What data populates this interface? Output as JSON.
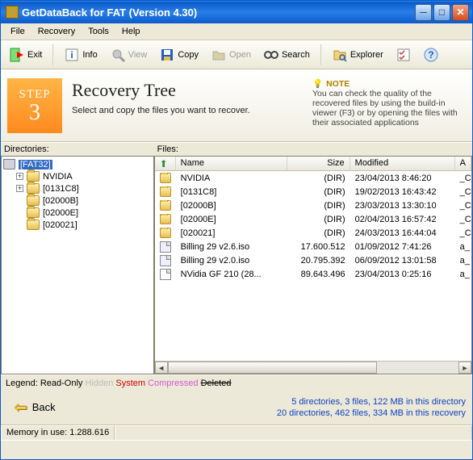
{
  "titlebar": {
    "title": "GetDataBack for FAT (Version 4.30)"
  },
  "menu": {
    "file": "File",
    "recovery": "Recovery",
    "tools": "Tools",
    "help": "Help"
  },
  "toolbar": {
    "exit": "Exit",
    "info": "Info",
    "view": "View",
    "copy": "Copy",
    "open": "Open",
    "search": "Search",
    "explorer": "Explorer"
  },
  "step": {
    "label": "STEP",
    "number": "3",
    "title": "Recovery Tree",
    "subtitle": "Select and copy the files you want to recover."
  },
  "note": {
    "heading": "NOTE",
    "body": "You can check the quality of the recovered files by using the build-in viewer (F3) or by opening the files with their associated applications"
  },
  "labels": {
    "directories": "Directories:",
    "files": "Files:"
  },
  "tree": {
    "root": "[FAT32]",
    "items": [
      {
        "name": "NVIDIA",
        "expandable": true
      },
      {
        "name": "[0131C8]",
        "expandable": true
      },
      {
        "name": "[02000B]",
        "expandable": false
      },
      {
        "name": "[02000E]",
        "expandable": false
      },
      {
        "name": "[020021]",
        "expandable": false
      }
    ]
  },
  "columns": {
    "name": "Name",
    "size": "Size",
    "modified": "Modified",
    "attr": "A"
  },
  "files": [
    {
      "icon": "folder",
      "name": "NVIDIA",
      "size": "(DIR)",
      "modified": "23/04/2013 8:46:20",
      "attr": "_C"
    },
    {
      "icon": "folder",
      "name": "[0131C8]",
      "size": "(DIR)",
      "modified": "19/02/2013 16:43:42",
      "attr": "_C"
    },
    {
      "icon": "folder",
      "name": "[02000B]",
      "size": "(DIR)",
      "modified": "23/03/2013 13:30:10",
      "attr": "_C"
    },
    {
      "icon": "folder",
      "name": "[02000E]",
      "size": "(DIR)",
      "modified": "02/04/2013 16:57:42",
      "attr": "_C"
    },
    {
      "icon": "folder",
      "name": "[020021]",
      "size": "(DIR)",
      "modified": "24/03/2013 16:44:04",
      "attr": "_C"
    },
    {
      "icon": "iso",
      "name": "Billing 29 v2.6.iso",
      "size": "17.600.512",
      "modified": "01/09/2012 7:41:26",
      "attr": "a_"
    },
    {
      "icon": "iso",
      "name": "Billing 29 v2.0.iso",
      "size": "20.795.392",
      "modified": "06/09/2012 13:01:58",
      "attr": "a_"
    },
    {
      "icon": "file",
      "name": "NVidia GF 210 (28...",
      "size": "89.643.496",
      "modified": "23/04/2013 0:25:16",
      "attr": "a_"
    }
  ],
  "legend": {
    "label": "Legend:",
    "ro": "Read-Only",
    "hidden": "Hidden",
    "system": "System",
    "compressed": "Compressed",
    "deleted": "Deleted"
  },
  "back": "Back",
  "summary": {
    "line1": "5 directories, 3 files, 122 MB in this directory",
    "line2": "20 directories, 462 files, 334 MB in this recovery"
  },
  "status": {
    "memory": "Memory in use: 1.288.616"
  }
}
